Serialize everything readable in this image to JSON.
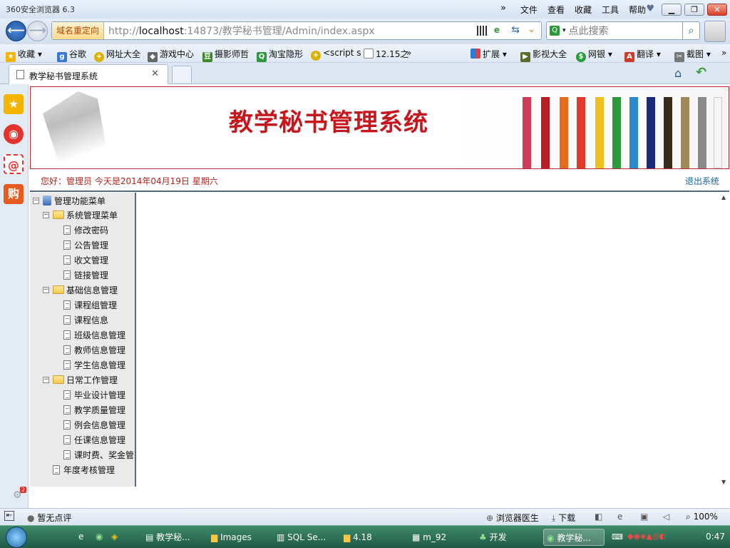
{
  "browser": {
    "title": "360安全浏览器 6.3",
    "menu": [
      "文件",
      "查看",
      "收藏",
      "工具",
      "帮助"
    ],
    "redirect_tag": "域名重定向",
    "url_prefix": "http://",
    "url_host": "localhost",
    "url_rest": ":14873/教学秘书管理/Admin/index.aspx",
    "search_placeholder": "点此搜索"
  },
  "favorites": {
    "left": [
      "收藏",
      "谷歌",
      "网址大全",
      "游戏中心",
      "摄影师哲",
      "淘宝隐形",
      "<script s",
      "12.15之"
    ],
    "right": [
      "扩展",
      "影视大全",
      "网银",
      "翻译",
      "截图"
    ]
  },
  "tab": {
    "title": "教学秘书管理系统"
  },
  "site": {
    "title": "教学秘书管理系统",
    "greeting": "您好：管理员    今天是2014年04月19日    星期六",
    "logout": "退出系统"
  },
  "tree": {
    "root": "管理功能菜单",
    "groups": [
      {
        "label": "系统管理菜单",
        "items": [
          "修改密码",
          "公告管理",
          "收文管理",
          "链接管理"
        ]
      },
      {
        "label": "基础信息管理",
        "items": [
          "课程组管理",
          "课程信息",
          "班级信息管理",
          "教师信息管理",
          "学生信息管理"
        ]
      },
      {
        "label": "日常工作管理",
        "items": [
          "毕业设计管理",
          "教学质量管理",
          "例会信息管理",
          "任课信息管理",
          "课时费、奖金管"
        ]
      }
    ],
    "last": "年度考核管理"
  },
  "status": {
    "comment": "暂无点评",
    "doctor": "浏览器医生",
    "download": "下载",
    "zoom": "100%",
    "badge": "2"
  },
  "taskbar": {
    "items": [
      "教学秘...",
      "Images",
      "SQL Se...",
      "4.18",
      "m_92",
      "开发",
      "教学秘..."
    ],
    "time": "0:47"
  },
  "colors": {
    "brand_red": "#c8161d",
    "tree_bg": "#eaeaea",
    "taskbar": "#2d6e55"
  }
}
